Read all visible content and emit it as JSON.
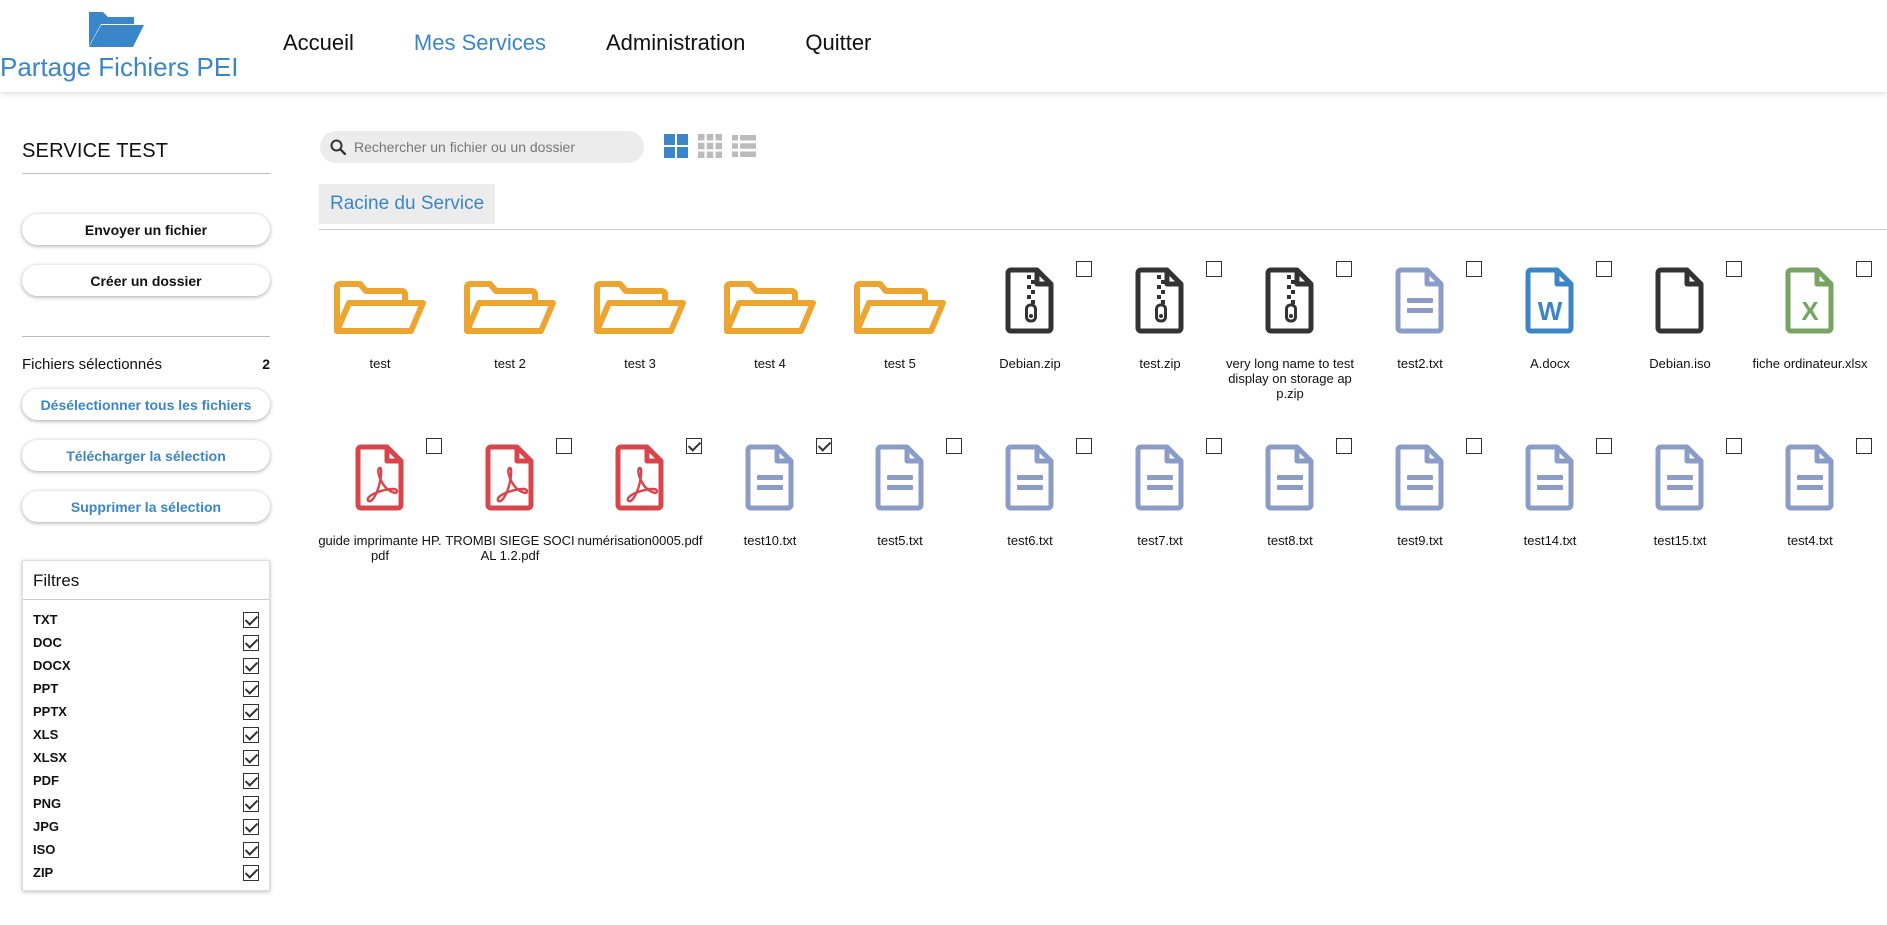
{
  "app": {
    "title": "Partage Fichiers PEI",
    "nav": [
      {
        "label": "Accueil",
        "active": false
      },
      {
        "label": "Mes Services",
        "active": true
      },
      {
        "label": "Administration",
        "active": false
      },
      {
        "label": "Quitter",
        "active": false
      }
    ]
  },
  "sidebar": {
    "service_name": "SERVICE TEST",
    "upload_label": "Envoyer un fichier",
    "create_folder_label": "Créer un dossier",
    "selected_label": "Fichiers sélectionnés",
    "selected_count": "2",
    "deselect_label": "Désélectionner tous les fichiers",
    "download_label": "Télécharger la sélection",
    "delete_label": "Supprimer la sélection",
    "filters_title": "Filtres",
    "filters": [
      {
        "label": "TXT",
        "checked": true
      },
      {
        "label": "DOC",
        "checked": true
      },
      {
        "label": "DOCX",
        "checked": true
      },
      {
        "label": "PPT",
        "checked": true
      },
      {
        "label": "PPTX",
        "checked": true
      },
      {
        "label": "XLS",
        "checked": true
      },
      {
        "label": "XLSX",
        "checked": true
      },
      {
        "label": "PDF",
        "checked": true
      },
      {
        "label": "PNG",
        "checked": true
      },
      {
        "label": "JPG",
        "checked": true
      },
      {
        "label": "ISO",
        "checked": true
      },
      {
        "label": "ZIP",
        "checked": true
      }
    ]
  },
  "main": {
    "search_placeholder": "Rechercher un fichier ou un dossier",
    "breadcrumb": "Racine du Service",
    "items": [
      {
        "name": "test",
        "type": "folder"
      },
      {
        "name": "test 2",
        "type": "folder"
      },
      {
        "name": "test 3",
        "type": "folder"
      },
      {
        "name": "test 4",
        "type": "folder"
      },
      {
        "name": "test 5",
        "type": "folder"
      },
      {
        "name": "Debian.zip",
        "type": "zip",
        "checked": false
      },
      {
        "name": "test.zip",
        "type": "zip",
        "checked": false
      },
      {
        "name": "very long name to test display on storage app.zip",
        "type": "zip",
        "checked": false
      },
      {
        "name": "test2.txt",
        "type": "txt",
        "checked": false
      },
      {
        "name": "A.docx",
        "type": "docx",
        "checked": false
      },
      {
        "name": "Debian.iso",
        "type": "iso",
        "checked": false
      },
      {
        "name": "fiche ordinateur.xlsx",
        "type": "xlsx",
        "checked": false
      },
      {
        "name": "guide imprimante HP.pdf",
        "type": "pdf",
        "checked": false
      },
      {
        "name": "TROMBI SIEGE SOCIAL 1.2.pdf",
        "type": "pdf",
        "checked": false
      },
      {
        "name": "numérisation0005.pdf",
        "type": "pdf",
        "checked": true
      },
      {
        "name": "test10.txt",
        "type": "txt",
        "checked": true
      },
      {
        "name": "test5.txt",
        "type": "txt",
        "checked": false
      },
      {
        "name": "test6.txt",
        "type": "txt",
        "checked": false
      },
      {
        "name": "test7.txt",
        "type": "txt",
        "checked": false
      },
      {
        "name": "test8.txt",
        "type": "txt",
        "checked": false
      },
      {
        "name": "test9.txt",
        "type": "txt",
        "checked": false
      },
      {
        "name": "test14.txt",
        "type": "txt",
        "checked": false
      },
      {
        "name": "test15.txt",
        "type": "txt",
        "checked": false
      },
      {
        "name": "test4.txt",
        "type": "txt",
        "checked": false
      }
    ]
  },
  "colors": {
    "accent": "#3a86c8",
    "folder": "#eda532",
    "zip": "#333333",
    "txt": "#8b9cc9",
    "docx": "#3d85c6",
    "iso": "#333333",
    "xlsx": "#77a463",
    "pdf": "#d9454a"
  },
  "icons": {
    "logo": "folder-open-icon",
    "search": "search-icon",
    "view_large": "large-grid-view-icon",
    "view_small": "small-grid-view-icon",
    "view_list": "list-view-icon"
  }
}
